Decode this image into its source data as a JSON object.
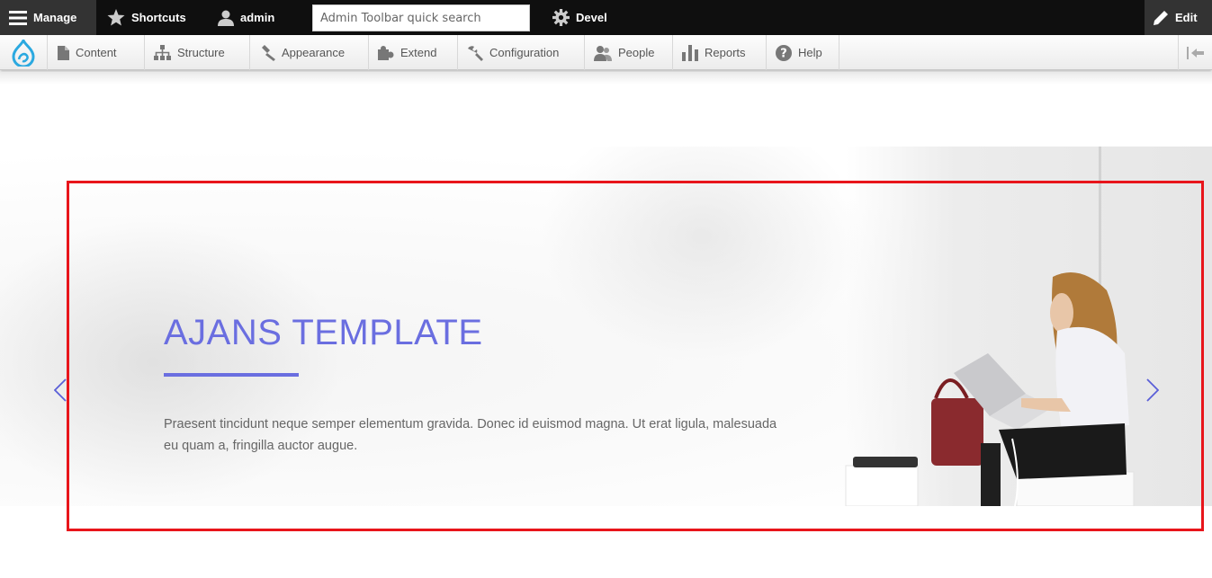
{
  "toolbar": {
    "manage_label": "Manage",
    "shortcuts_label": "Shortcuts",
    "user_label": "admin",
    "search_placeholder": "Admin Toolbar quick search",
    "devel_label": "Devel",
    "edit_label": "Edit"
  },
  "menu": {
    "items": [
      {
        "label": "Content",
        "icon": "file-icon"
      },
      {
        "label": "Structure",
        "icon": "sitemap-icon"
      },
      {
        "label": "Appearance",
        "icon": "paintbrush-icon"
      },
      {
        "label": "Extend",
        "icon": "puzzle-icon"
      },
      {
        "label": "Configuration",
        "icon": "wrench-icon"
      },
      {
        "label": "People",
        "icon": "people-icon"
      },
      {
        "label": "Reports",
        "icon": "bar-chart-icon"
      },
      {
        "label": "Help",
        "icon": "help-icon"
      }
    ]
  },
  "hero": {
    "title": "AJANS TEMPLATE",
    "text": "Praesent tincidunt neque semper elementum gravida. Donec id euismod magna. Ut erat ligula, malesuada eu quam a, fringilla auctor augue."
  },
  "colors": {
    "accent": "#6a6ee0",
    "toolbar_bg": "#0f0f0f",
    "highlight_frame": "#e8151b",
    "drupal_blue": "#2ba9e0"
  }
}
